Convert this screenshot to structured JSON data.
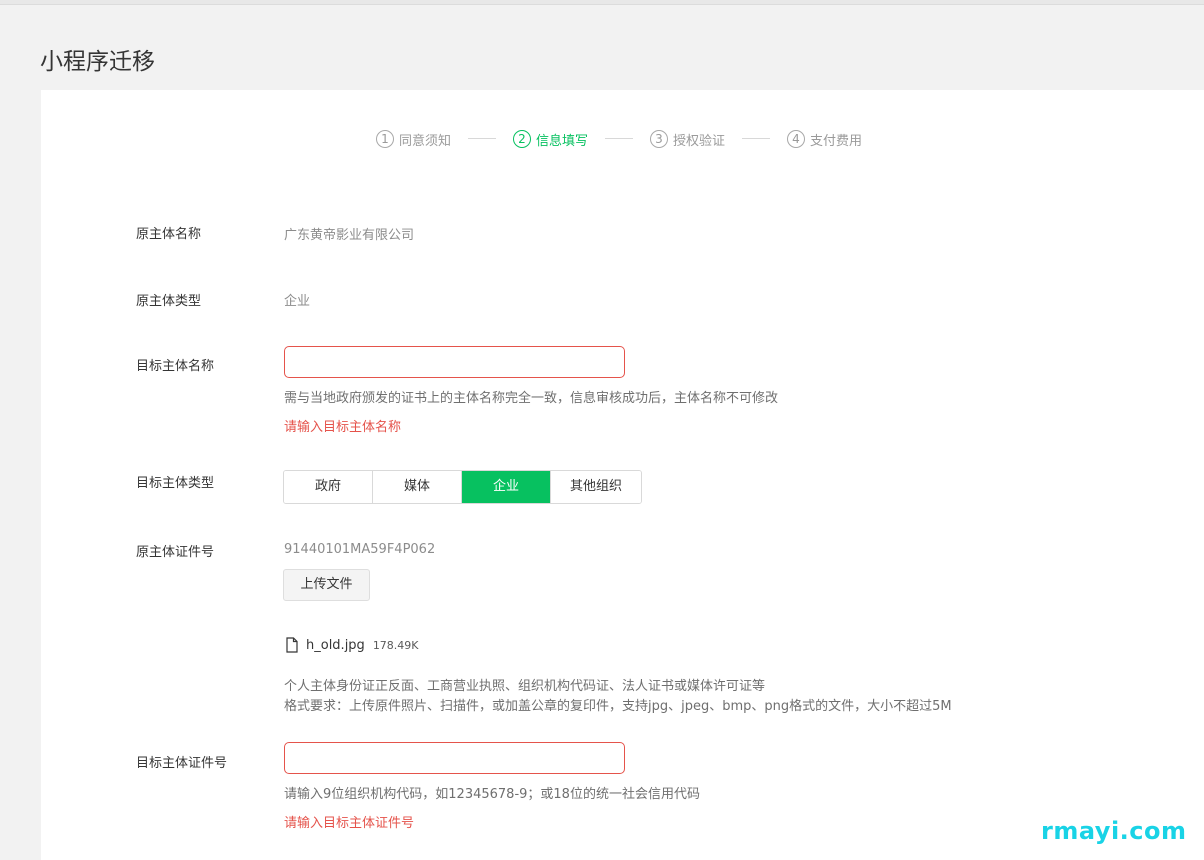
{
  "page_title": "小程序迁移",
  "steps": [
    {
      "num": "1",
      "label": "同意须知",
      "state": "done"
    },
    {
      "num": "2",
      "label": "信息填写",
      "state": "active"
    },
    {
      "num": "3",
      "label": "授权验证",
      "state": "pending"
    },
    {
      "num": "4",
      "label": "支付费用",
      "state": "pending"
    }
  ],
  "form": {
    "original_name": {
      "label": "原主体名称",
      "value": "广东黄帝影业有限公司"
    },
    "original_type": {
      "label": "原主体类型",
      "value": "企业"
    },
    "target_name": {
      "label": "目标主体名称",
      "value": "",
      "placeholder": "",
      "hint": "需与当地政府颁发的证书上的主体名称完全一致，信息审核成功后，主体名称不可修改",
      "error": "请输入目标主体名称"
    },
    "target_type": {
      "label": "目标主体类型",
      "options": [
        "政府",
        "媒体",
        "企业",
        "其他组织"
      ],
      "selected": "企业"
    },
    "original_cert": {
      "label": "原主体证件号",
      "value": "91440101MA59F4P062",
      "upload_label": "上传文件",
      "file_name": "h_old.jpg",
      "file_size": "178.49K",
      "hint_line1": "个人主体身份证正反面、工商营业执照、组织机构代码证、法人证书或媒体许可证等",
      "hint_line2": "格式要求：上传原件照片、扫描件，或加盖公章的复印件，支持jpg、jpeg、bmp、png格式的文件，大小不超过5M"
    },
    "target_cert": {
      "label": "目标主体证件号",
      "value": "",
      "placeholder": "",
      "hint": "请输入9位组织机构代码，如12345678-9；或18位的统一社会信用代码",
      "error": "请输入目标主体证件号"
    }
  },
  "watermark": "rmayi.com",
  "colors": {
    "accent": "#07c160",
    "error": "#e5534b"
  }
}
